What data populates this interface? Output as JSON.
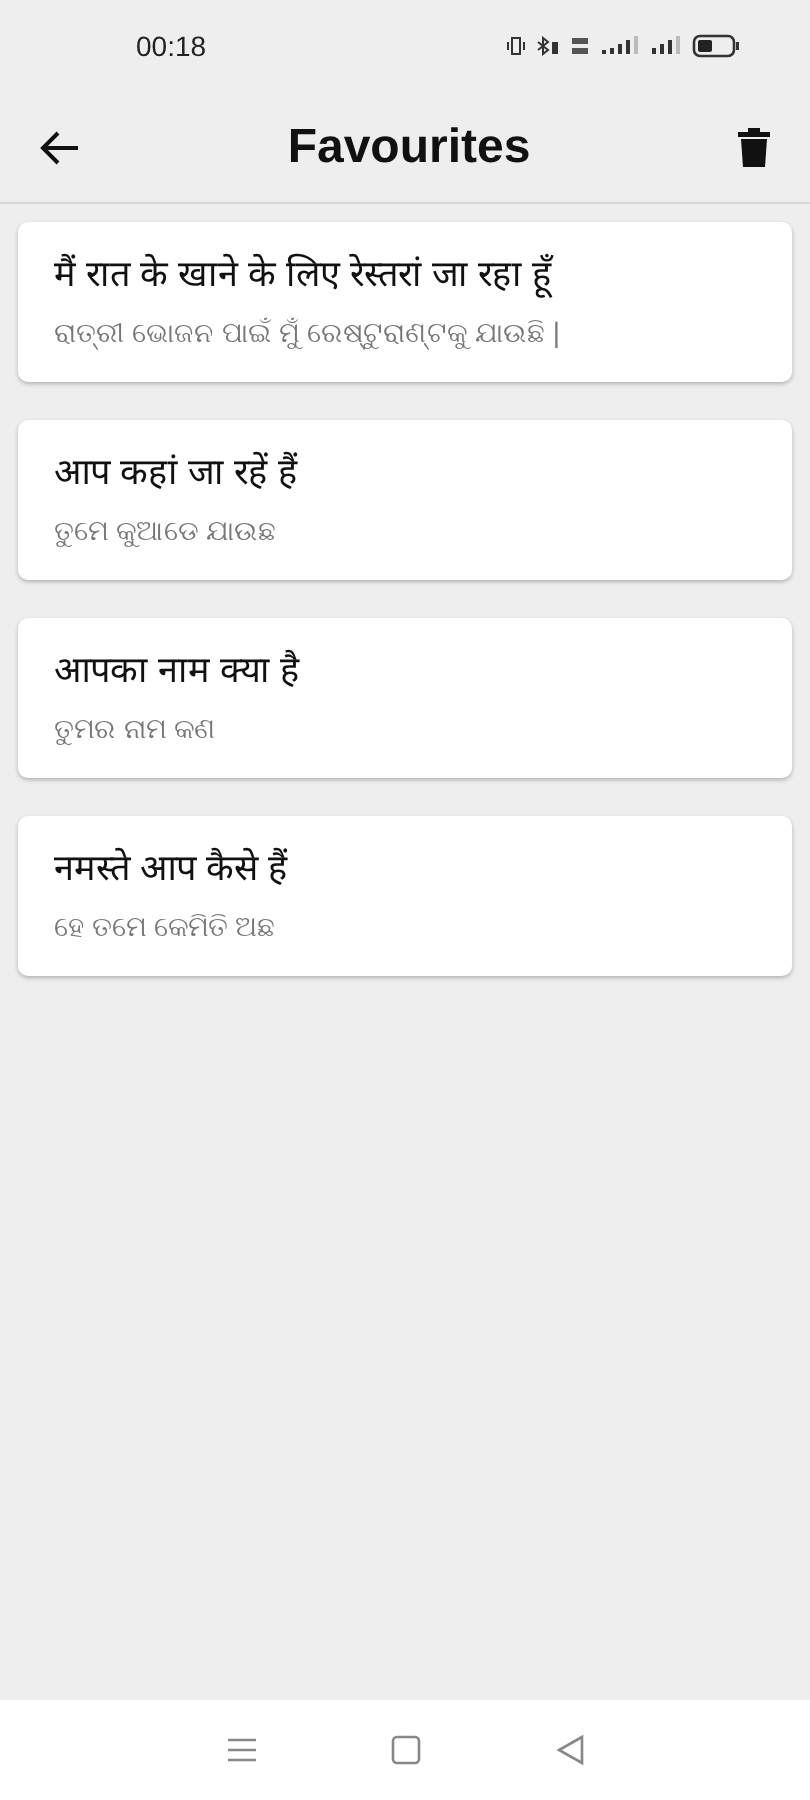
{
  "status_bar": {
    "time": "00:18"
  },
  "header": {
    "title": "Favourites"
  },
  "favourites": [
    {
      "source": "मैं रात के खाने के लिए रेस्तरां जा रहा हूँ",
      "translation": "ରାତ୍ରୀ ଭୋଜନ ପାଇଁ ମୁଁ ରେଷ୍ଟୁରାଣ୍ଟକୁ ଯାଉଛି |"
    },
    {
      "source": "आप कहां जा रहें हैं",
      "translation": "ତୁମେ କୁଆଡେ ଯାଉଛ"
    },
    {
      "source": "आपका नाम क्या है",
      "translation": "ତୁମର ନାମ କଣ"
    },
    {
      "source": "नमस्ते आप कैसे हैं",
      "translation": "ହେ ତମେ କେମିତି ଅଛ"
    }
  ]
}
